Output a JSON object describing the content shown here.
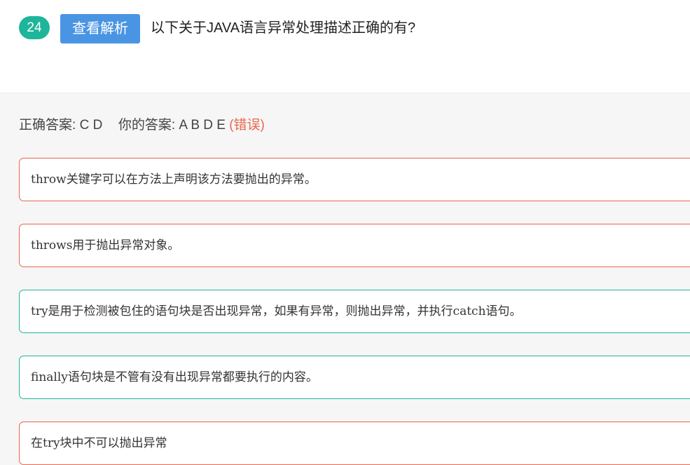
{
  "question": {
    "number": "24",
    "analysis_button_label": "查看解析",
    "text": "以下关于JAVA语言异常处理描述正确的有?"
  },
  "answer": {
    "correct_label": "正确答案:",
    "correct_value": "C D",
    "yours_label": "你的答案:",
    "yours_value": "A B D E",
    "status": "(错误)"
  },
  "options": [
    {
      "text": "throw关键字可以在方法上声明该方法要抛出的异常。",
      "state": "wrong"
    },
    {
      "text": "throws用于抛出异常对象。",
      "state": "wrong"
    },
    {
      "text": "try是用于检测被包住的语句块是否出现异常，如果有异常，则抛出异常，并执行catch语句。",
      "state": "correct"
    },
    {
      "text": "finally语句块是不管有没有出现异常都要执行的内容。",
      "state": "correct"
    },
    {
      "text": "在try块中不可以抛出异常",
      "state": "wrong"
    }
  ],
  "colors": {
    "number_badge": "#1fb59a",
    "analysis_button": "#4a95e3",
    "wrong_border": "#e8674e",
    "correct_border": "#1fb59a",
    "wrong_text": "#e8674e",
    "section_background": "#f6f6f6"
  }
}
